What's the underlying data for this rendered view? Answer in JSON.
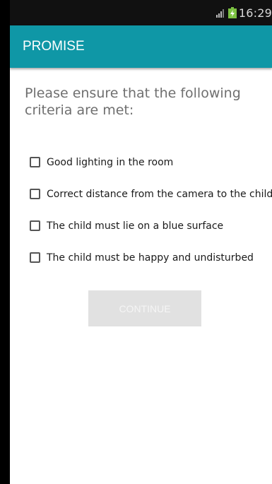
{
  "status_bar": {
    "time": "16:29",
    "icons": [
      "signal-icon",
      "battery-charging-icon"
    ]
  },
  "app_bar": {
    "title": "PROMISE"
  },
  "main": {
    "heading": "Please ensure that the following criteria are met:",
    "criteria": [
      {
        "label": "Good lighting in the room",
        "checked": false
      },
      {
        "label": "Correct distance from the camera to the child",
        "checked": false
      },
      {
        "label": "The child must lie on a blue surface",
        "checked": false
      },
      {
        "label": "The child must be happy and undisturbed",
        "checked": false
      }
    ],
    "continue_label": "CONTINUE",
    "continue_enabled": false
  },
  "colors": {
    "app_bar": "#0f97a6",
    "status_bar": "#111111",
    "heading_text": "#6f6f6f",
    "button_disabled_bg": "#e1e1e1",
    "battery_charge": "#7cc242"
  }
}
